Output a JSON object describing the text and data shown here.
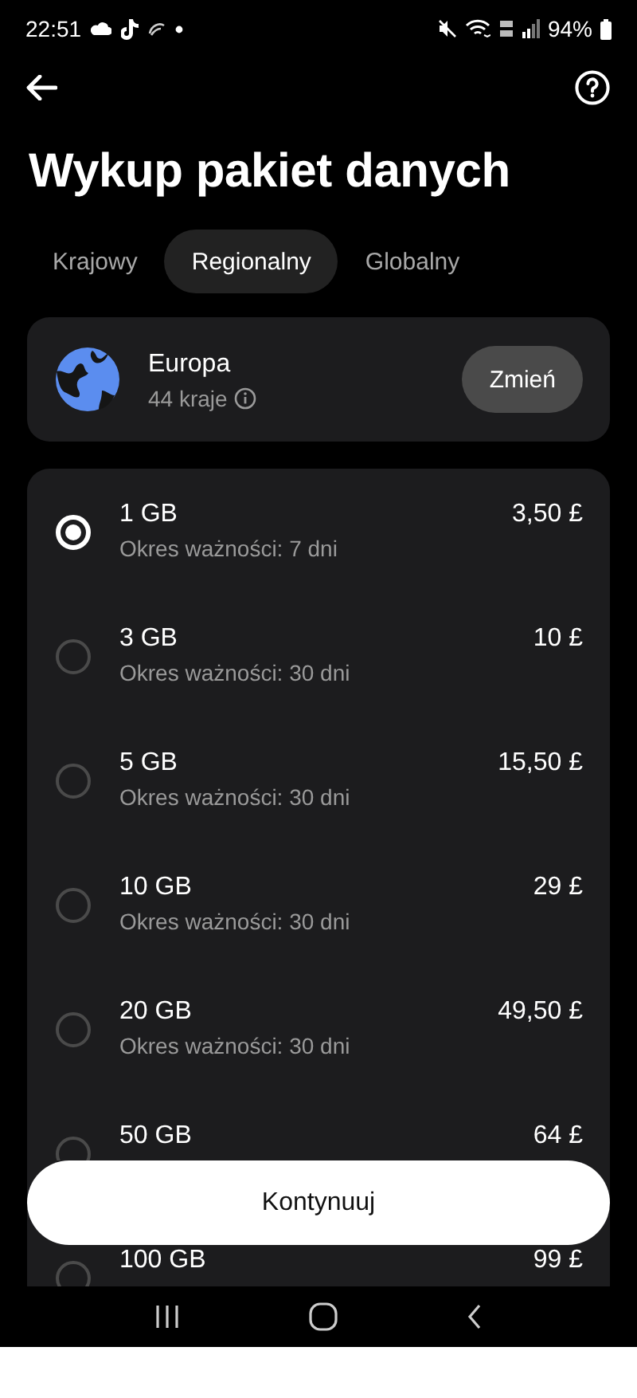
{
  "status_bar": {
    "time": "22:51",
    "battery": "94%"
  },
  "title": "Wykup pakiet danych",
  "tabs": [
    {
      "label": "Krajowy",
      "selected": false
    },
    {
      "label": "Regionalny",
      "selected": true
    },
    {
      "label": "Globalny",
      "selected": false
    }
  ],
  "region": {
    "name": "Europa",
    "subtitle": "44 kraje",
    "action": "Zmień"
  },
  "plans": [
    {
      "data": "1 GB",
      "validity": "Okres ważności: 7 dni",
      "price": "3,50 £",
      "selected": true
    },
    {
      "data": "3 GB",
      "validity": "Okres ważności: 30 dni",
      "price": "10 £",
      "selected": false
    },
    {
      "data": "5 GB",
      "validity": "Okres ważności: 30 dni",
      "price": "15,50 £",
      "selected": false
    },
    {
      "data": "10 GB",
      "validity": "Okres ważności: 30 dni",
      "price": "29 £",
      "selected": false
    },
    {
      "data": "20 GB",
      "validity": "Okres ważności: 30 dni",
      "price": "49,50 £",
      "selected": false
    },
    {
      "data": "50 GB",
      "price": "64 £",
      "selected": false
    },
    {
      "data": "100 GB",
      "price": "99 £",
      "selected": false
    }
  ],
  "continue_button": "Kontynuuj"
}
